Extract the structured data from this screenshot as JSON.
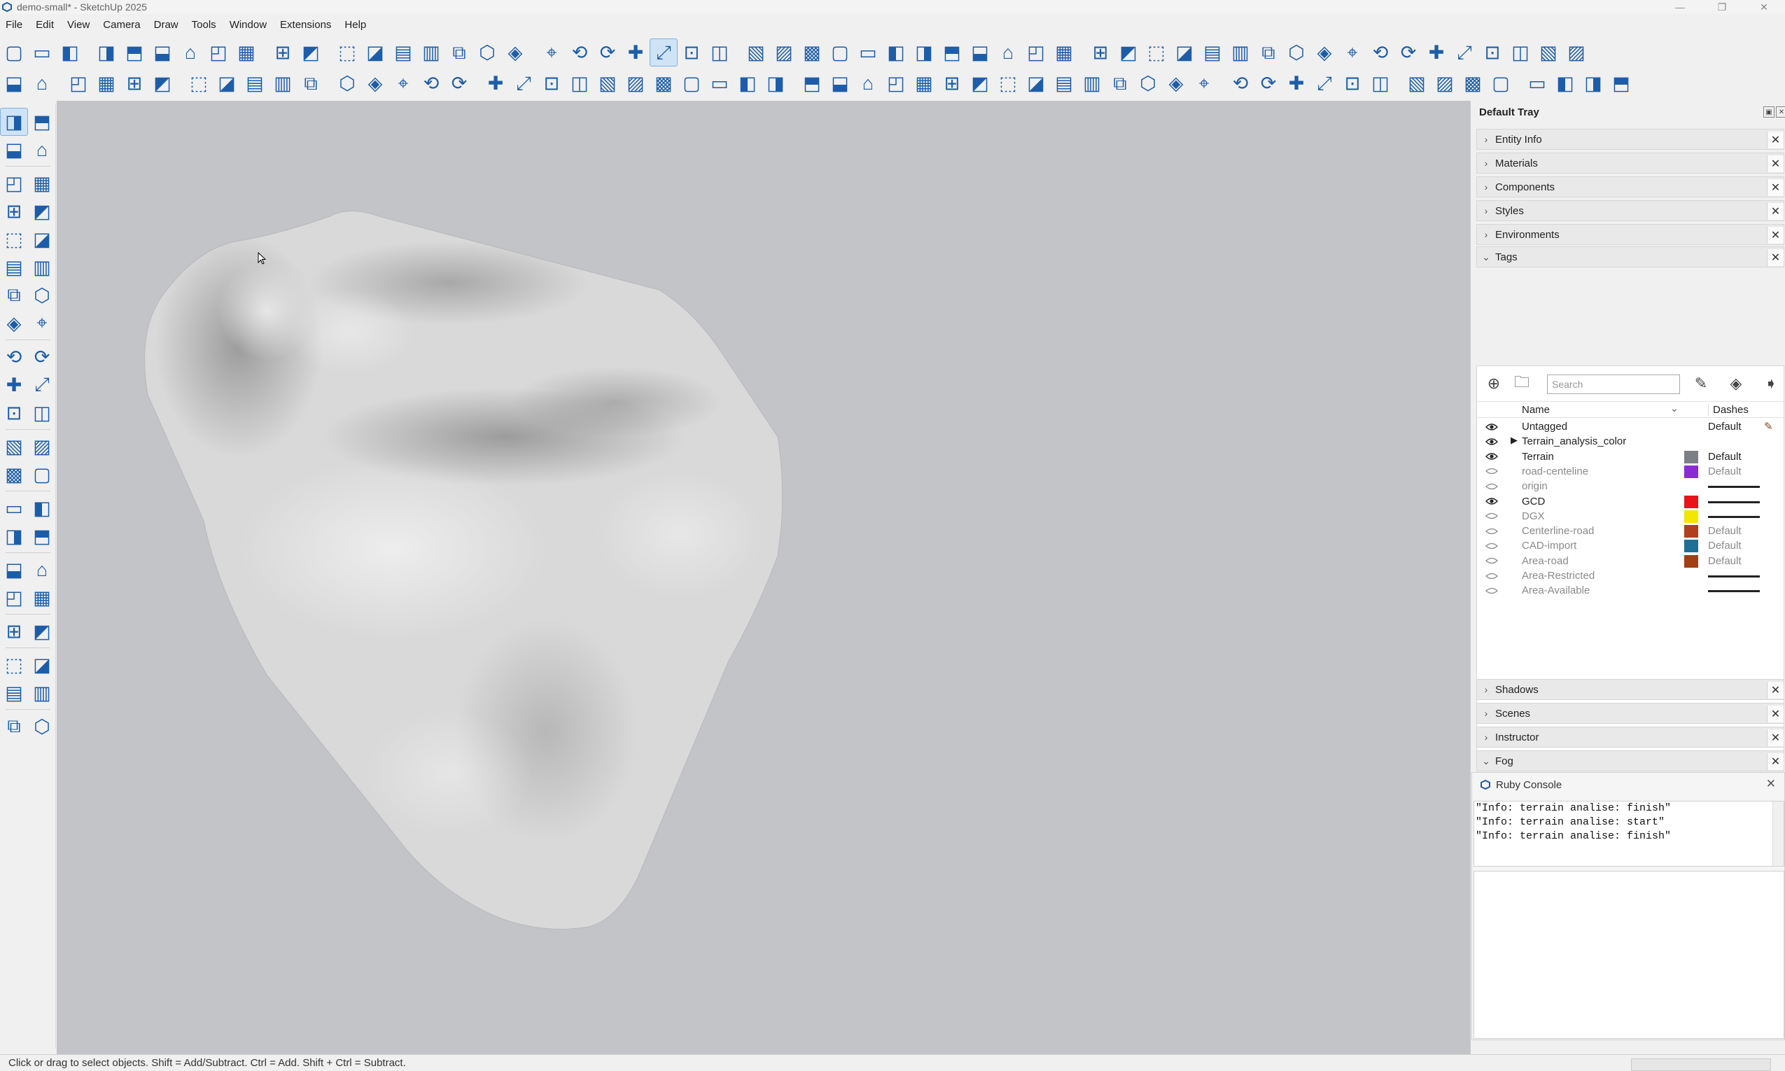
{
  "window": {
    "title": "demo-small* - SketchUp 2025",
    "minimize": "—",
    "maximize": "❐",
    "close": "✕"
  },
  "menu": [
    "File",
    "Edit",
    "View",
    "Camera",
    "Draw",
    "Tools",
    "Window",
    "Extensions",
    "Help"
  ],
  "toolbar_row1": [
    "new-file-icon",
    "open-folder-icon",
    "save-icon",
    "cut-icon",
    "copy-icon",
    "paste-icon",
    "erase-icon",
    "undo-icon",
    "redo-icon",
    "print-icon",
    "model-info-icon",
    "iso-view-icon",
    "top-view-icon",
    "front-view-icon",
    "right-view-icon",
    "back-view-icon",
    "left-view-icon",
    "bottom-view-icon",
    "xray-icon",
    "back-edges-icon",
    "wireframe-icon",
    "hidden-line-icon",
    "shaded-icon",
    "shaded-textures-icon",
    "monochrome-icon",
    "warehouse-icon",
    "text-tool-icon",
    "tree-icon",
    "pin-icon",
    "compass-icon",
    "tower-icon",
    "box-icon",
    "grid-icon",
    "frame-icon",
    "resize-icon",
    "hide-icon",
    "section-icon",
    "zoom-icon",
    "protractor-icon",
    "dimension-icon",
    "tape-icon",
    "swap-icon",
    "layers-icon",
    "lock-icon",
    "slope-icon",
    "network-icon",
    "group-icon",
    "table-icon",
    "strip-icon",
    "snowflake-icon",
    "move-axes-icon",
    "auto-icon",
    "arrow-export-icon",
    "tiles-icon",
    "map-icon"
  ],
  "toolbar_row2": [
    "menu-icon",
    "sun-icon",
    "globe-icon",
    "bounding-icon",
    "tent-icon",
    "mountains-icon",
    "columns-icon",
    "plane-icon",
    "plane2-icon",
    "grid-solid-icon",
    "bin-icon",
    "percent-icon",
    "sparkle-icon",
    "sparkle2-icon",
    "pipe-icon",
    "grid-dots-icon",
    "stamp-icon",
    "switch-icon",
    "magnify-icon",
    "loop-icon",
    "magnify2-icon",
    "dial-icon",
    "anchor-icon",
    "link-icon",
    "fence-icon",
    "axis-icon",
    "blocks-icon",
    "add-box-icon",
    "cloud-cad-icon",
    "ruler-icon",
    "branch-icon",
    "photo-icon",
    "slab-icon",
    "crosshair-icon",
    "calc-icon",
    "sliders-icon",
    "dropbox-icon",
    "wallet-icon",
    "banknote-icon",
    "kwh-icon",
    "irr-icon",
    "clipboard-icon",
    "gear-icon",
    "users-icon",
    "en-icon",
    "help-icon",
    "cloud-up-icon",
    "refresh-icon",
    "db-icon",
    "loss-icon",
    "bi-icon",
    "play-icon",
    "resize-x-icon",
    "scissors-icon",
    "scale-icon",
    "obj-icon"
  ],
  "left_tools": [
    "select-icon",
    "lasso-icon",
    "paint-icon",
    "eraser-icon",
    "tag-icon",
    "tag2-icon",
    "pencil-icon",
    "freehand-icon",
    "rectangle-icon",
    "rotated-rect-icon",
    "circle-icon",
    "polygon-icon",
    "arc-icon",
    "arc2-icon",
    "arc3-icon",
    "pie-icon",
    "move-icon",
    "pushpull-icon",
    "rotate-icon",
    "followme-icon",
    "scale-icon",
    "offset-icon",
    "tape-icon",
    "dimension-icon",
    "protractor-icon",
    "text-icon",
    "axes-icon",
    "3dtext-icon",
    "section-icon",
    "hand-icon",
    "zoom-icon",
    "zoomwin-icon",
    "zoomext-icon",
    "prev-view-icon",
    "position-cam-icon",
    "walk-icon",
    "look-around-icon",
    "sandbox-icon",
    "smoove-icon",
    "stamp-icon",
    "drape-icon",
    "flip-icon"
  ],
  "tray": {
    "title": "Default Tray",
    "panels_top": [
      "Entity Info",
      "Materials",
      "Components",
      "Styles",
      "Environments"
    ],
    "tags_label": "Tags",
    "panels_bottom": [
      "Shadows",
      "Scenes",
      "Instructor",
      "Fog"
    ]
  },
  "tags": {
    "search_placeholder": "Search",
    "col_name": "Name",
    "col_dashes": "Dashes",
    "rows": [
      {
        "name": "Untagged",
        "visible": true,
        "color": "",
        "dash": "Default",
        "expand": false,
        "pen": true
      },
      {
        "name": "Terrain_analysis_color",
        "visible": true,
        "color": "",
        "dash": "",
        "expand": true,
        "pen": false
      },
      {
        "name": "Terrain",
        "visible": true,
        "color": "#7c7f86",
        "dash": "Default",
        "expand": false,
        "pen": false
      },
      {
        "name": "road-centeline",
        "visible": false,
        "color": "#8b2bd6",
        "dash": "Default",
        "expand": false,
        "pen": false
      },
      {
        "name": "origin",
        "visible": false,
        "color": "",
        "dash": "line",
        "expand": false,
        "pen": false
      },
      {
        "name": "GCD",
        "visible": true,
        "color": "#e8141a",
        "dash": "line",
        "expand": false,
        "pen": false
      },
      {
        "name": "DGX",
        "visible": false,
        "color": "#f2e600",
        "dash": "line",
        "expand": false,
        "pen": false
      },
      {
        "name": "Centerline-road",
        "visible": false,
        "color": "#b0401d",
        "dash": "Default",
        "expand": false,
        "pen": false
      },
      {
        "name": "CAD-import",
        "visible": false,
        "color": "#1f6e94",
        "dash": "Default",
        "expand": false,
        "pen": false
      },
      {
        "name": "Area-road",
        "visible": false,
        "color": "#a04014",
        "dash": "Default",
        "expand": false,
        "pen": false
      },
      {
        "name": "Area-Restricted",
        "visible": false,
        "color": "",
        "dash": "line",
        "expand": false,
        "pen": false
      },
      {
        "name": "Area-Available",
        "visible": false,
        "color": "",
        "dash": "line",
        "expand": false,
        "pen": false
      }
    ]
  },
  "ruby_console": {
    "title": "Ruby Console",
    "lines": [
      "\"Info: terrain analise: finish\"",
      "\"Info: terrain analise: start\"",
      "\"Info: terrain analise: finish\""
    ]
  },
  "status": "Click or drag to select objects. Shift = Add/Subtract. Ctrl = Add. Shift + Ctrl = Subtract."
}
